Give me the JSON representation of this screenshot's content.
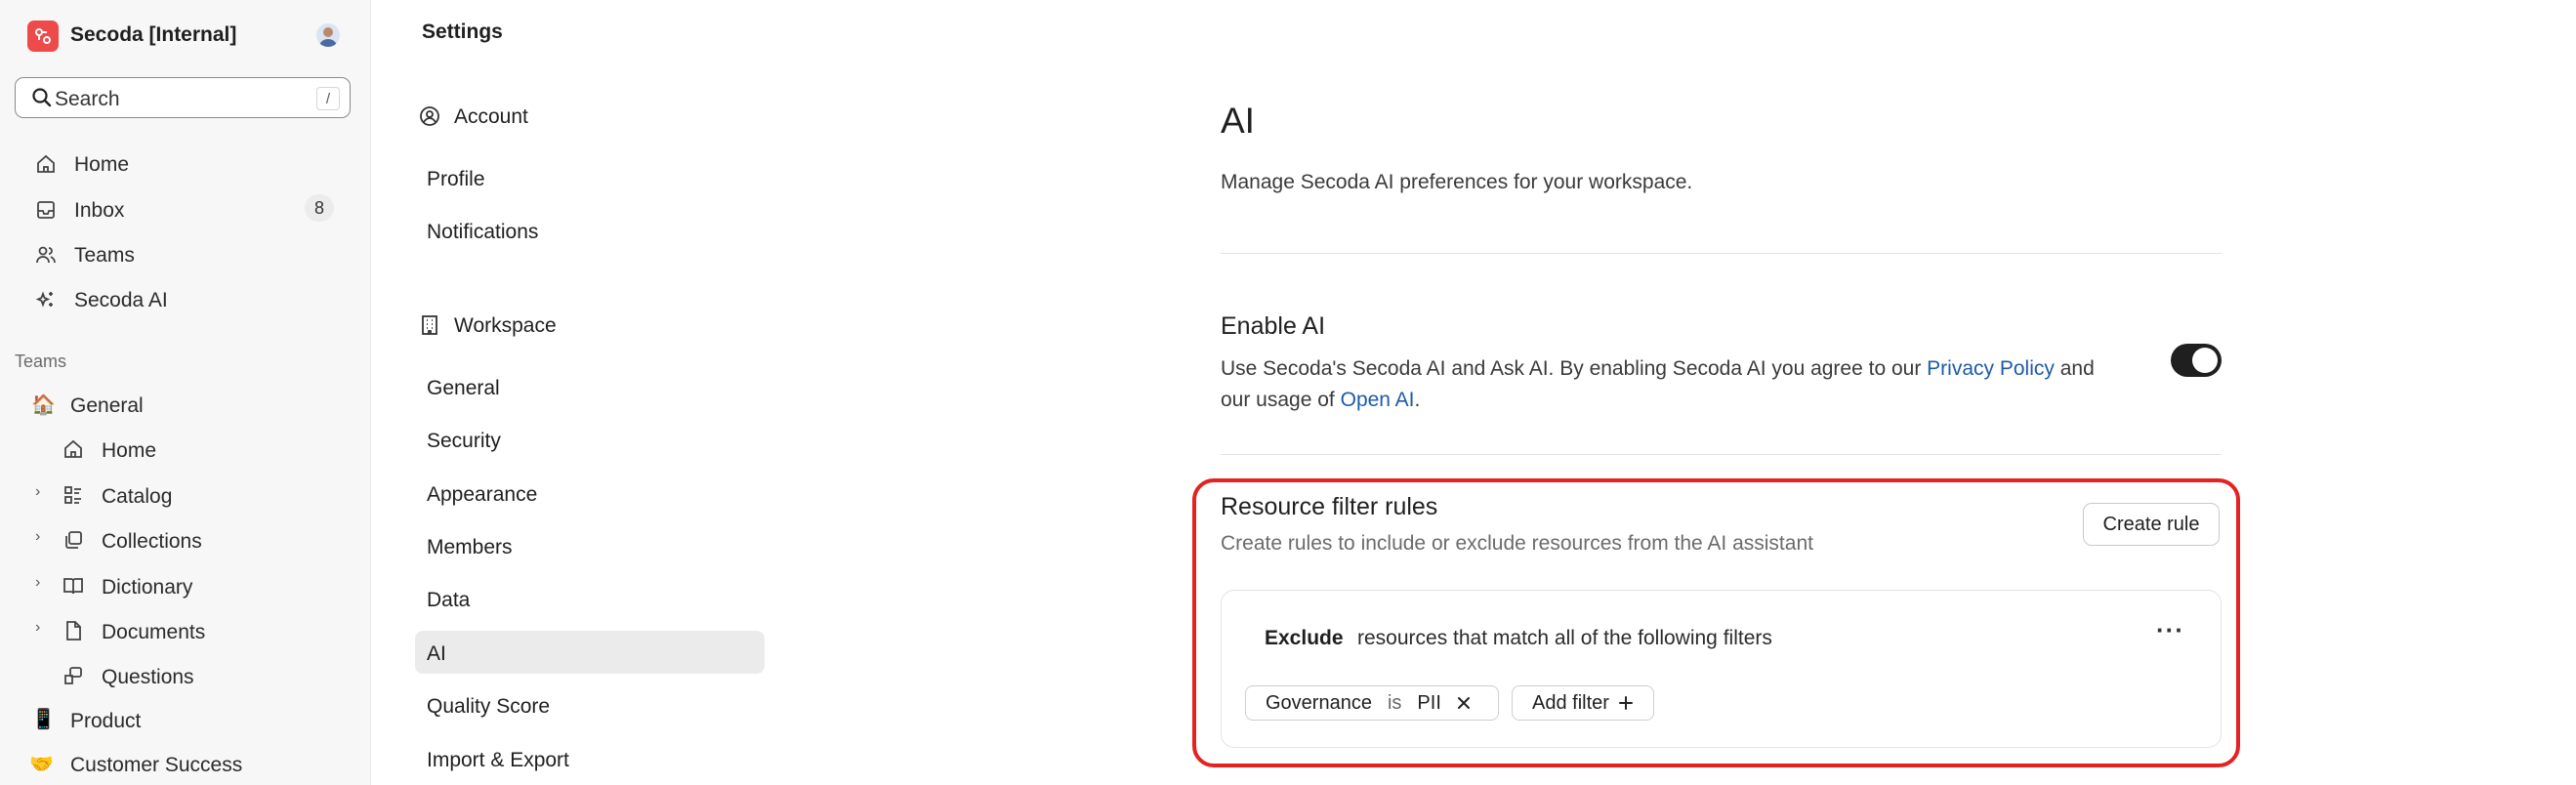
{
  "workspace": {
    "name": "Secoda [Internal]"
  },
  "search": {
    "label": "Search",
    "shortcut": "/"
  },
  "nav": {
    "items": [
      {
        "label": "Home",
        "icon": "home-icon"
      },
      {
        "label": "Inbox",
        "icon": "inbox-icon",
        "badge": "8"
      },
      {
        "label": "Teams",
        "icon": "users-icon"
      },
      {
        "label": "Secoda AI",
        "icon": "sparkles-icon"
      }
    ],
    "teams_label": "Teams",
    "teams": [
      {
        "label": "General",
        "icon": "house-emoji-icon"
      },
      {
        "label": "Home",
        "icon": "home-icon"
      },
      {
        "label": "Catalog",
        "icon": "catalog-icon"
      },
      {
        "label": "Collections",
        "icon": "collections-icon"
      },
      {
        "label": "Dictionary",
        "icon": "book-icon"
      },
      {
        "label": "Documents",
        "icon": "document-icon"
      },
      {
        "label": "Questions",
        "icon": "questions-icon"
      },
      {
        "label": "Product",
        "icon": "phone-emoji-icon"
      },
      {
        "label": "Customer Success",
        "icon": "handshake-emoji-icon"
      }
    ]
  },
  "settings": {
    "title": "Settings",
    "account_label": "Account",
    "account_items": [
      "Profile",
      "Notifications"
    ],
    "workspace_label": "Workspace",
    "workspace_items": [
      "General",
      "Security",
      "Appearance",
      "Members",
      "Data",
      "AI",
      "Quality Score",
      "Import & Export"
    ],
    "active": "AI"
  },
  "main": {
    "title": "AI",
    "description": "Manage Secoda AI preferences for your workspace.",
    "enable_ai": {
      "title": "Enable AI",
      "text_1": "Use Secoda's Secoda AI and Ask AI. By enabling Secoda AI you agree to our",
      "privacy_link": "Privacy Policy",
      "text_2": "and",
      "text_3": "our usage of",
      "openai_link": "Open AI",
      "text_4": ".",
      "enabled": true
    },
    "resource_rules": {
      "title": "Resource filter rules",
      "description": "Create rules to include or exclude resources from the AI assistant",
      "create_button": "Create rule",
      "rule": {
        "mode": "Exclude",
        "text": "resources that match all of the following filters",
        "filter": {
          "field": "Governance",
          "operator": "is",
          "value": "PII"
        },
        "add_filter": "Add filter"
      }
    }
  },
  "colors": {
    "accent_red": "#e52222",
    "link": "#1e5aa8",
    "logo": "#ef4a4a"
  }
}
